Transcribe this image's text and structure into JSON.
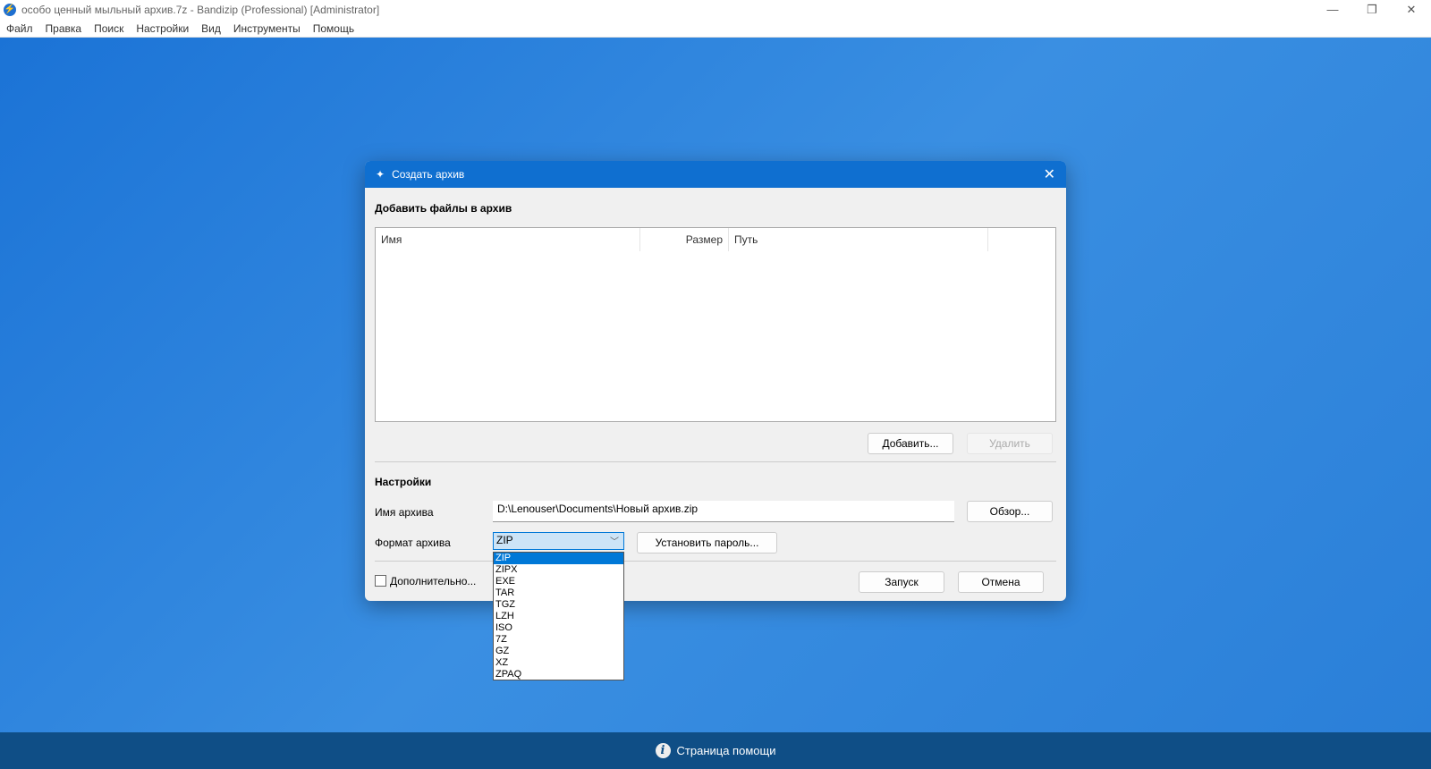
{
  "window": {
    "title": "особо ценный мыльный архив.7z - Bandizip (Professional) [Administrator]",
    "minimize": "—",
    "maximize": "❐",
    "close": "✕"
  },
  "menu": [
    "Файл",
    "Правка",
    "Поиск",
    "Настройки",
    "Вид",
    "Инструменты",
    "Помощь"
  ],
  "dialog": {
    "title": "Создать архив",
    "close": "✕",
    "add_files_heading": "Добавить файлы в архив",
    "columns": [
      "Имя",
      "Размер",
      "Путь"
    ],
    "add_button": "Добавить...",
    "remove_button": "Удалить",
    "settings_heading": "Настройки",
    "archive_name_label": "Имя архива",
    "archive_name_value": "D:\\Lenouser\\Documents\\Новый архив.zip",
    "browse_button": "Обзор...",
    "format_label": "Формат архива",
    "format_value": "ZIP",
    "password_button": "Установить пароль...",
    "advanced_label": "Дополнительно...",
    "start_button": "Запуск",
    "cancel_button": "Отмена",
    "format_options": [
      "ZIP",
      "ZIPX",
      "EXE",
      "TAR",
      "TGZ",
      "LZH",
      "ISO",
      "7Z",
      "GZ",
      "XZ",
      "ZPAQ"
    ]
  },
  "footer": {
    "help": "Страница помощи"
  }
}
